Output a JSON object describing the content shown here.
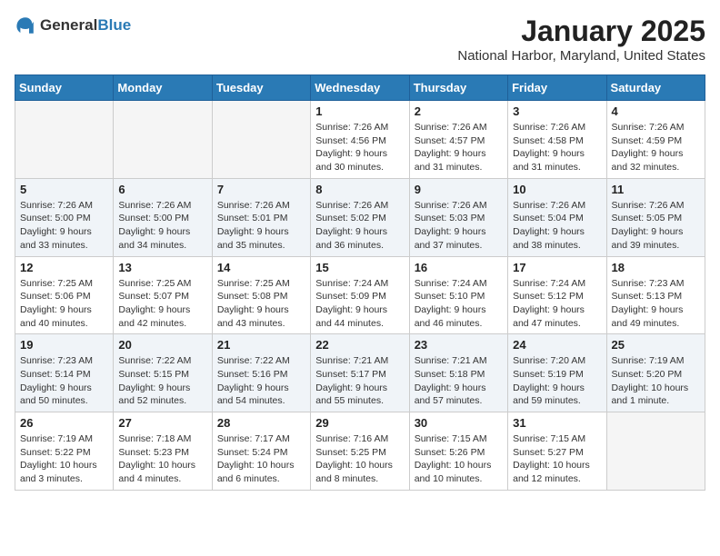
{
  "header": {
    "logo_general": "General",
    "logo_blue": "Blue",
    "month_title": "January 2025",
    "location": "National Harbor, Maryland, United States"
  },
  "weekdays": [
    "Sunday",
    "Monday",
    "Tuesday",
    "Wednesday",
    "Thursday",
    "Friday",
    "Saturday"
  ],
  "weeks": [
    [
      {
        "day": "",
        "info": ""
      },
      {
        "day": "",
        "info": ""
      },
      {
        "day": "",
        "info": ""
      },
      {
        "day": "1",
        "info": "Sunrise: 7:26 AM\nSunset: 4:56 PM\nDaylight: 9 hours\nand 30 minutes."
      },
      {
        "day": "2",
        "info": "Sunrise: 7:26 AM\nSunset: 4:57 PM\nDaylight: 9 hours\nand 31 minutes."
      },
      {
        "day": "3",
        "info": "Sunrise: 7:26 AM\nSunset: 4:58 PM\nDaylight: 9 hours\nand 31 minutes."
      },
      {
        "day": "4",
        "info": "Sunrise: 7:26 AM\nSunset: 4:59 PM\nDaylight: 9 hours\nand 32 minutes."
      }
    ],
    [
      {
        "day": "5",
        "info": "Sunrise: 7:26 AM\nSunset: 5:00 PM\nDaylight: 9 hours\nand 33 minutes."
      },
      {
        "day": "6",
        "info": "Sunrise: 7:26 AM\nSunset: 5:00 PM\nDaylight: 9 hours\nand 34 minutes."
      },
      {
        "day": "7",
        "info": "Sunrise: 7:26 AM\nSunset: 5:01 PM\nDaylight: 9 hours\nand 35 minutes."
      },
      {
        "day": "8",
        "info": "Sunrise: 7:26 AM\nSunset: 5:02 PM\nDaylight: 9 hours\nand 36 minutes."
      },
      {
        "day": "9",
        "info": "Sunrise: 7:26 AM\nSunset: 5:03 PM\nDaylight: 9 hours\nand 37 minutes."
      },
      {
        "day": "10",
        "info": "Sunrise: 7:26 AM\nSunset: 5:04 PM\nDaylight: 9 hours\nand 38 minutes."
      },
      {
        "day": "11",
        "info": "Sunrise: 7:26 AM\nSunset: 5:05 PM\nDaylight: 9 hours\nand 39 minutes."
      }
    ],
    [
      {
        "day": "12",
        "info": "Sunrise: 7:25 AM\nSunset: 5:06 PM\nDaylight: 9 hours\nand 40 minutes."
      },
      {
        "day": "13",
        "info": "Sunrise: 7:25 AM\nSunset: 5:07 PM\nDaylight: 9 hours\nand 42 minutes."
      },
      {
        "day": "14",
        "info": "Sunrise: 7:25 AM\nSunset: 5:08 PM\nDaylight: 9 hours\nand 43 minutes."
      },
      {
        "day": "15",
        "info": "Sunrise: 7:24 AM\nSunset: 5:09 PM\nDaylight: 9 hours\nand 44 minutes."
      },
      {
        "day": "16",
        "info": "Sunrise: 7:24 AM\nSunset: 5:10 PM\nDaylight: 9 hours\nand 46 minutes."
      },
      {
        "day": "17",
        "info": "Sunrise: 7:24 AM\nSunset: 5:12 PM\nDaylight: 9 hours\nand 47 minutes."
      },
      {
        "day": "18",
        "info": "Sunrise: 7:23 AM\nSunset: 5:13 PM\nDaylight: 9 hours\nand 49 minutes."
      }
    ],
    [
      {
        "day": "19",
        "info": "Sunrise: 7:23 AM\nSunset: 5:14 PM\nDaylight: 9 hours\nand 50 minutes."
      },
      {
        "day": "20",
        "info": "Sunrise: 7:22 AM\nSunset: 5:15 PM\nDaylight: 9 hours\nand 52 minutes."
      },
      {
        "day": "21",
        "info": "Sunrise: 7:22 AM\nSunset: 5:16 PM\nDaylight: 9 hours\nand 54 minutes."
      },
      {
        "day": "22",
        "info": "Sunrise: 7:21 AM\nSunset: 5:17 PM\nDaylight: 9 hours\nand 55 minutes."
      },
      {
        "day": "23",
        "info": "Sunrise: 7:21 AM\nSunset: 5:18 PM\nDaylight: 9 hours\nand 57 minutes."
      },
      {
        "day": "24",
        "info": "Sunrise: 7:20 AM\nSunset: 5:19 PM\nDaylight: 9 hours\nand 59 minutes."
      },
      {
        "day": "25",
        "info": "Sunrise: 7:19 AM\nSunset: 5:20 PM\nDaylight: 10 hours\nand 1 minute."
      }
    ],
    [
      {
        "day": "26",
        "info": "Sunrise: 7:19 AM\nSunset: 5:22 PM\nDaylight: 10 hours\nand 3 minutes."
      },
      {
        "day": "27",
        "info": "Sunrise: 7:18 AM\nSunset: 5:23 PM\nDaylight: 10 hours\nand 4 minutes."
      },
      {
        "day": "28",
        "info": "Sunrise: 7:17 AM\nSunset: 5:24 PM\nDaylight: 10 hours\nand 6 minutes."
      },
      {
        "day": "29",
        "info": "Sunrise: 7:16 AM\nSunset: 5:25 PM\nDaylight: 10 hours\nand 8 minutes."
      },
      {
        "day": "30",
        "info": "Sunrise: 7:15 AM\nSunset: 5:26 PM\nDaylight: 10 hours\nand 10 minutes."
      },
      {
        "day": "31",
        "info": "Sunrise: 7:15 AM\nSunset: 5:27 PM\nDaylight: 10 hours\nand 12 minutes."
      },
      {
        "day": "",
        "info": ""
      }
    ]
  ]
}
